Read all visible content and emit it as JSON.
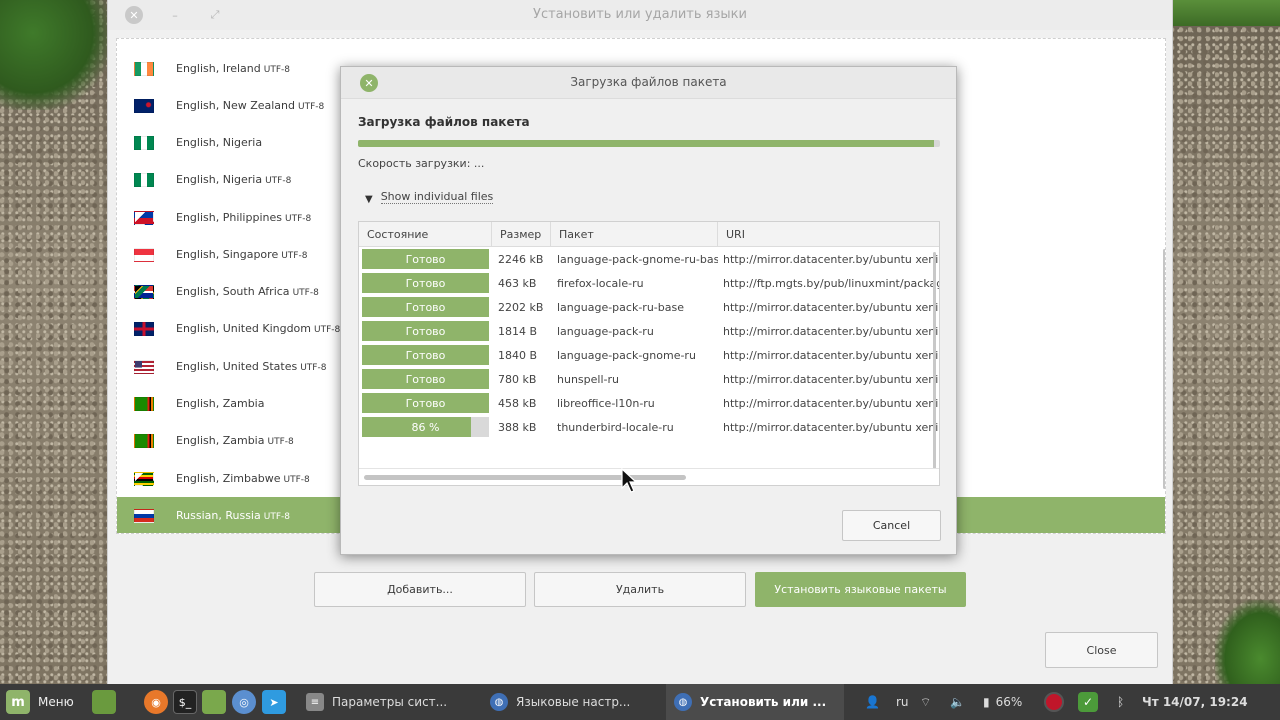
{
  "main_window": {
    "title": "Установить или удалить языки",
    "controls": {
      "close": "✕",
      "minimize": "–",
      "maximize": "⤢"
    },
    "languages": [
      {
        "name": "English, Ireland",
        "encoding": "UTF-8",
        "flag": "ireland-flag",
        "selected": false
      },
      {
        "name": "English, New Zealand",
        "encoding": "UTF-8",
        "flag": "new-zealand-flag",
        "selected": false
      },
      {
        "name": "English, Nigeria",
        "encoding": "",
        "flag": "nigeria-flag",
        "selected": false
      },
      {
        "name": "English, Nigeria",
        "encoding": "UTF-8",
        "flag": "nigeria-flag",
        "selected": false
      },
      {
        "name": "English, Philippines",
        "encoding": "UTF-8",
        "flag": "philippines-flag",
        "selected": false
      },
      {
        "name": "English, Singapore",
        "encoding": "UTF-8",
        "flag": "singapore-flag",
        "selected": false
      },
      {
        "name": "English, South Africa",
        "encoding": "UTF-8",
        "flag": "south-africa-flag",
        "selected": false
      },
      {
        "name": "English, United Kingdom",
        "encoding": "UTF-8",
        "flag": "united-kingdom-flag",
        "selected": false
      },
      {
        "name": "English, United States",
        "encoding": "UTF-8",
        "flag": "united-states-flag",
        "selected": false
      },
      {
        "name": "English, Zambia",
        "encoding": "",
        "flag": "zambia-flag",
        "selected": false
      },
      {
        "name": "English, Zambia",
        "encoding": "UTF-8",
        "flag": "zambia-flag",
        "selected": false
      },
      {
        "name": "English, Zimbabwe",
        "encoding": "UTF-8",
        "flag": "zimbabwe-flag",
        "selected": false
      },
      {
        "name": "Russian, Russia",
        "encoding": "UTF-8",
        "flag": "russia-flag",
        "selected": true
      }
    ],
    "buttons": {
      "add": "Добавить...",
      "remove": "Удалить",
      "install": "Установить языковые пакеты",
      "close": "Close"
    }
  },
  "dialog": {
    "title": "Загрузка файлов пакета",
    "heading": "Загрузка файлов пакета",
    "overall_progress": 0.99,
    "speed_text": "Скорость загрузки: ...",
    "expander_label": "Show individual files",
    "columns": [
      "Состояние",
      "Размер",
      "Пакет",
      "URI"
    ],
    "files": [
      {
        "state": "Готово",
        "progress": 1.0,
        "size": "2246 kB",
        "package": "language-pack-gnome-ru-base",
        "uri": "http://mirror.datacenter.by/ubuntu xenial/main"
      },
      {
        "state": "Готово",
        "progress": 1.0,
        "size": "463 kB",
        "package": "firefox-locale-ru",
        "uri": "http://ftp.mgts.by/pub/linuxmint/packages"
      },
      {
        "state": "Готово",
        "progress": 1.0,
        "size": "2202 kB",
        "package": "language-pack-ru-base",
        "uri": "http://mirror.datacenter.by/ubuntu xenial/main"
      },
      {
        "state": "Готово",
        "progress": 1.0,
        "size": "1814  B",
        "package": "language-pack-ru",
        "uri": "http://mirror.datacenter.by/ubuntu xenial/main"
      },
      {
        "state": "Готово",
        "progress": 1.0,
        "size": "1840  B",
        "package": "language-pack-gnome-ru",
        "uri": "http://mirror.datacenter.by/ubuntu xenial/main"
      },
      {
        "state": "Готово",
        "progress": 1.0,
        "size": "780 kB",
        "package": "hunspell-ru",
        "uri": "http://mirror.datacenter.by/ubuntu xenial/main"
      },
      {
        "state": "Готово",
        "progress": 1.0,
        "size": "458 kB",
        "package": "libreoffice-l10n-ru",
        "uri": "http://mirror.datacenter.by/ubuntu xenial-updates"
      },
      {
        "state": "86 %",
        "progress": 0.86,
        "size": "388 kB",
        "package": "thunderbird-locale-ru",
        "uri": "http://mirror.datacenter.by/ubuntu xenial-updates"
      }
    ],
    "cancel_label": "Cancel"
  },
  "taskbar": {
    "menu_label": "Меню",
    "launchers": [
      "desktop-icon",
      "firefox-icon",
      "terminal-icon",
      "files-icon",
      "chromium-icon",
      "telegram-icon"
    ],
    "tasks": [
      {
        "label": "Параметры сист...",
        "icon": "settings-icon",
        "active": false
      },
      {
        "label": "Языковые настр...",
        "icon": "language-icon",
        "active": false
      },
      {
        "label": "Установить или ...",
        "icon": "language-icon",
        "active": true
      }
    ],
    "tray": {
      "keyboard_layout": "ru",
      "battery_percent": "66%",
      "clock": "Чт 14/07, 19:24"
    }
  },
  "colors": {
    "accent": "#8fb46a",
    "taskbar": "#3a3a3a",
    "window_bg": "#f0f0f0"
  }
}
